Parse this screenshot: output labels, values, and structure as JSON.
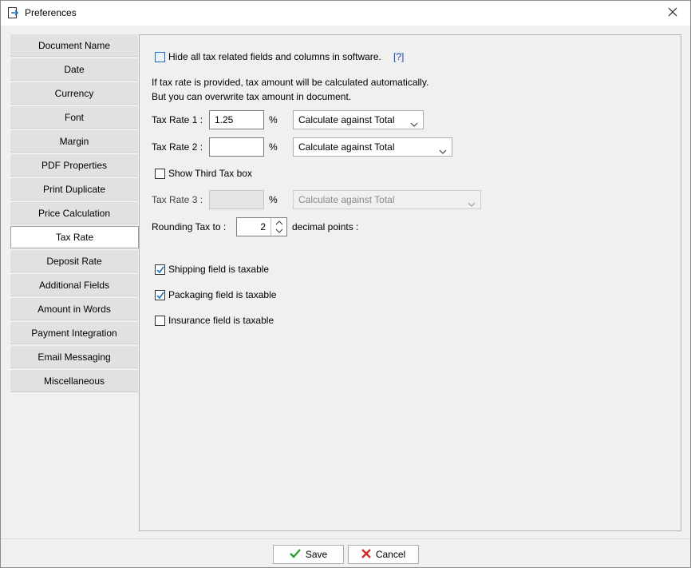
{
  "window": {
    "title": "Preferences"
  },
  "nav": {
    "items": [
      {
        "label": "Document Name",
        "active": false
      },
      {
        "label": "Date",
        "active": false
      },
      {
        "label": "Currency",
        "active": false
      },
      {
        "label": "Font",
        "active": false
      },
      {
        "label": "Margin",
        "active": false
      },
      {
        "label": "PDF Properties",
        "active": false
      },
      {
        "label": "Print Duplicate",
        "active": false
      },
      {
        "label": "Price Calculation",
        "active": false
      },
      {
        "label": "Tax Rate",
        "active": true
      },
      {
        "label": "Deposit Rate",
        "active": false
      },
      {
        "label": "Additional Fields",
        "active": false
      },
      {
        "label": "Amount in Words",
        "active": false
      },
      {
        "label": "Payment Integration",
        "active": false
      },
      {
        "label": "Email Messaging",
        "active": false
      },
      {
        "label": "Miscellaneous",
        "active": false
      }
    ]
  },
  "tax": {
    "hide_all_label": "Hide all tax related fields and columns in software.",
    "hide_all_checked": false,
    "help_link": "[?]",
    "info_line1": "If tax rate is provided, tax amount will be calculated automatically.",
    "info_line2": "But you can overwrite tax amount in document.",
    "rate1_label": "Tax Rate 1 :",
    "rate1_value": "1.25",
    "rate1_percent": "%",
    "rate1_method": "Calculate against Total",
    "rate2_label": "Tax Rate 2 :",
    "rate2_value": "",
    "rate2_percent": "%",
    "rate2_method": "Calculate against Total",
    "show_third_label": "Show Third Tax box",
    "show_third_checked": false,
    "rate3_label": "Tax Rate 3 :",
    "rate3_value": "",
    "rate3_percent": "%",
    "rate3_method": "Calculate against Total",
    "rounding_label": "Rounding Tax to  :",
    "rounding_value": "2",
    "rounding_suffix": "decimal points :",
    "shipping_label": "Shipping field is taxable",
    "shipping_checked": true,
    "packaging_label": "Packaging field is taxable",
    "packaging_checked": true,
    "insurance_label": "Insurance field is taxable",
    "insurance_checked": false
  },
  "footer": {
    "save_label": "Save",
    "cancel_label": "Cancel"
  },
  "colors": {
    "accent": "#1f6fc5",
    "save_icon": "#2e9e2e",
    "cancel_icon": "#d62828",
    "help_link": "#1a3fb0"
  }
}
